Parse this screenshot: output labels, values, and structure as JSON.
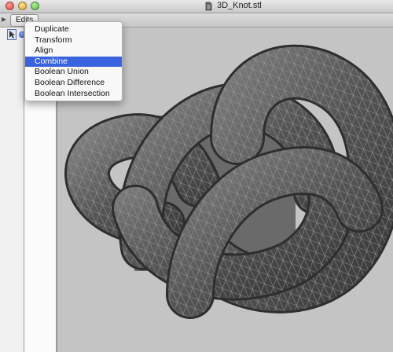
{
  "window": {
    "title": "3D_Knot.stl"
  },
  "toolbar": {
    "edits_label": "Edits"
  },
  "menu": {
    "items": [
      {
        "label": "Duplicate"
      },
      {
        "label": "Transform"
      },
      {
        "label": "Align"
      },
      {
        "label": "Combine",
        "selected": true
      },
      {
        "label": "Boolean Union"
      },
      {
        "label": "Boolean Difference"
      },
      {
        "label": "Boolean Intersection"
      }
    ]
  },
  "colors": {
    "menu_highlight": "#3a63df",
    "viewport_bg": "#c4c4c4",
    "mesh_fill": "#5b5b5b",
    "mesh_wire": "#9a9a9a",
    "backdrop_square": "#6a6a6a"
  },
  "icons": {
    "close": "window-close-icon",
    "minimize": "window-minimize-icon",
    "maximize": "window-maximize-icon",
    "document": "stl-document-icon",
    "tool_a": "cursor-tool-icon",
    "tool_b": "sphere-tool-icon"
  }
}
